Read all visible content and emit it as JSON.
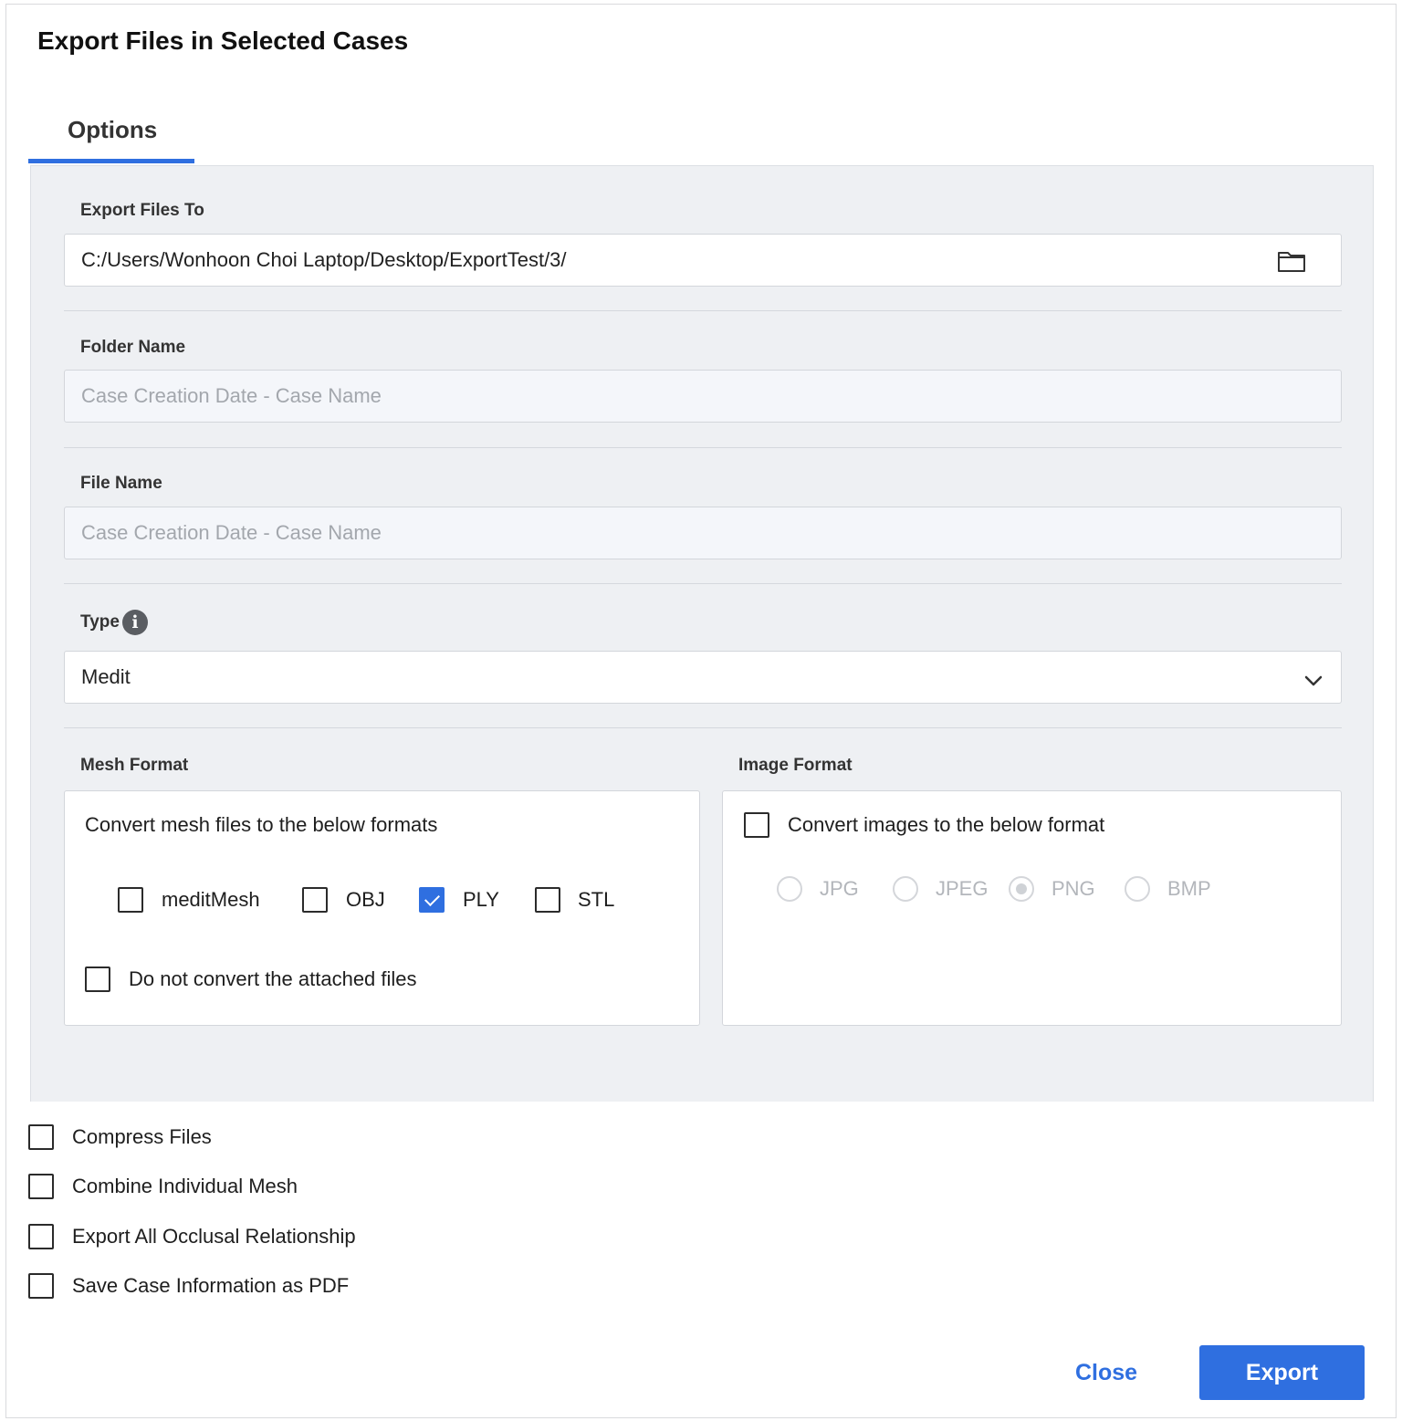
{
  "dialog": {
    "title": "Export Files in Selected Cases",
    "tab_label": "Options"
  },
  "export_to": {
    "label": "Export Files To",
    "value": "C:/Users/Wonhoon Choi Laptop/Desktop/ExportTest/3/",
    "icon": "folder-icon"
  },
  "folder_name": {
    "label": "Folder Name",
    "placeholder": "Case Creation Date - Case Name"
  },
  "file_name": {
    "label": "File Name",
    "placeholder": "Case Creation Date - Case Name"
  },
  "type": {
    "label": "Type",
    "info_icon_glyph": "i",
    "selected": "Medit"
  },
  "mesh_format": {
    "label": "Mesh Format",
    "description": "Convert mesh files to the below formats",
    "options": [
      {
        "label": "meditMesh",
        "checked": false
      },
      {
        "label": "OBJ",
        "checked": false
      },
      {
        "label": "PLY",
        "checked": true
      },
      {
        "label": "STL",
        "checked": false
      }
    ],
    "no_convert_label": "Do not convert the attached files",
    "no_convert_checked": false
  },
  "image_format": {
    "label": "Image Format",
    "convert_label": "Convert images to the below format",
    "convert_checked": false,
    "options": [
      "JPG",
      "JPEG",
      "PNG",
      "BMP"
    ],
    "selected": "PNG",
    "enabled": false
  },
  "extra_options": [
    {
      "label": "Compress Files",
      "checked": false
    },
    {
      "label": "Combine Individual Mesh",
      "checked": false
    },
    {
      "label": "Export All Occlusal Relationship",
      "checked": false
    },
    {
      "label": "Save Case Information as PDF",
      "checked": false
    }
  ],
  "buttons": {
    "close": "Close",
    "export": "Export"
  },
  "colors": {
    "accent": "#2f6fe0",
    "panel_bg": "#eef0f3",
    "disabled_text": "#a3a7ad"
  }
}
